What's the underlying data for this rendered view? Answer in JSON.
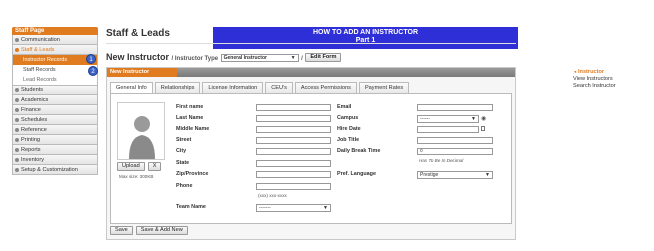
{
  "sidebar": {
    "header": "Staff Page",
    "items": [
      {
        "label": "Communication"
      },
      {
        "label": "Staff & Leads"
      }
    ],
    "sub_items": [
      {
        "label": "Instructor Records"
      },
      {
        "label": "Staff Records"
      },
      {
        "label": "Lead Records"
      }
    ],
    "items_after": [
      {
        "label": "Students"
      },
      {
        "label": "Academics"
      },
      {
        "label": "Finance"
      },
      {
        "label": "Schedules"
      },
      {
        "label": "Reference"
      },
      {
        "label": "Printing"
      },
      {
        "label": "Reports"
      },
      {
        "label": "Inventory"
      },
      {
        "label": "Setup & Customization"
      }
    ]
  },
  "callouts": [
    "1",
    "2"
  ],
  "page_title": "Staff & Leads",
  "banner": {
    "line1": "HOW TO ADD AN INSTRUCTOR",
    "line2": "Part 1"
  },
  "sub_header": {
    "title": "New Instructor",
    "type_label": "Instructor Type",
    "type_value": "General Instructor",
    "slash": "/",
    "edit_form": "Edit Form"
  },
  "panel": {
    "title": "New Instructor",
    "tabs": [
      "General Info",
      "Relationships",
      "License Information",
      "CEU's",
      "Access Permissions",
      "Payment Rates"
    ],
    "photo": {
      "upload": "Upload",
      "clear": "X",
      "note": "Max size: 300KB"
    },
    "left_fields": [
      {
        "label": "First name",
        "value": ""
      },
      {
        "label": "Last Name",
        "value": ""
      },
      {
        "label": "Middle Name",
        "value": ""
      },
      {
        "label": "Street",
        "value": ""
      },
      {
        "label": "City",
        "value": ""
      },
      {
        "label": "State",
        "value": ""
      },
      {
        "label": "Zip/Province",
        "value": ""
      },
      {
        "label": "Phone",
        "value": ""
      }
    ],
    "phone_hint": "(xxx) xxx-xxxx",
    "team_name": {
      "label": "Team Name",
      "value": "-------"
    },
    "right_fields": [
      {
        "label": "Email",
        "value": ""
      },
      {
        "label": "Campus",
        "value": "------"
      },
      {
        "label": "Hire Date",
        "value": ""
      },
      {
        "label": "Job Title",
        "value": ""
      },
      {
        "label": "Daily Break Time",
        "value": "0"
      }
    ],
    "decimal_hint": "Has To Be In Decimal",
    "pref_language": {
      "label": "Pref. Language",
      "value": "Prestige"
    },
    "buttons": {
      "save": "Save",
      "save_add": "Save & Add New"
    }
  },
  "right_links": {
    "current": "Instructor",
    "links": [
      "View Instructors",
      "Search Instructor"
    ]
  },
  "colors": {
    "accent": "#e07b20",
    "banner": "#2f2fd7",
    "callout": "#3b63c7"
  }
}
